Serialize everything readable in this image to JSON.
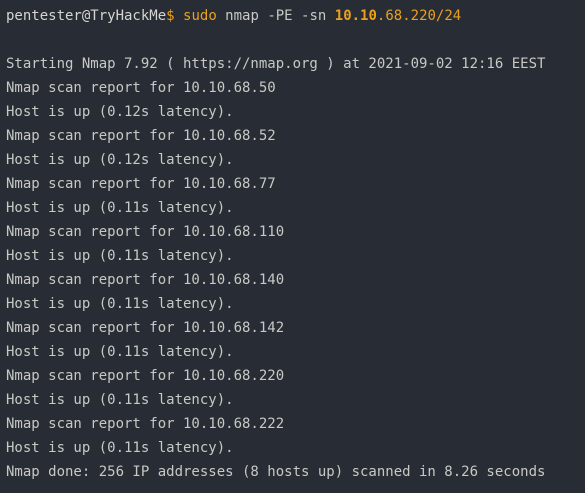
{
  "prompt": {
    "user_host": "pentester@TryHackMe",
    "symbol": "$",
    "sudo": "sudo",
    "args": " nmap -PE -sn ",
    "target_bold": "10.10",
    "target_rest": ".68.220/24"
  },
  "output": [
    "Starting Nmap 7.92 ( https://nmap.org ) at 2021-09-02 12:16 EEST",
    "Nmap scan report for 10.10.68.50",
    "Host is up (0.12s latency).",
    "Nmap scan report for 10.10.68.52",
    "Host is up (0.12s latency).",
    "Nmap scan report for 10.10.68.77",
    "Host is up (0.11s latency).",
    "Nmap scan report for 10.10.68.110",
    "Host is up (0.11s latency).",
    "Nmap scan report for 10.10.68.140",
    "Host is up (0.11s latency).",
    "Nmap scan report for 10.10.68.142",
    "Host is up (0.11s latency).",
    "Nmap scan report for 10.10.68.220",
    "Host is up (0.11s latency).",
    "Nmap scan report for 10.10.68.222",
    "Host is up (0.11s latency).",
    "Nmap done: 256 IP addresses (8 hosts up) scanned in 8.26 seconds"
  ],
  "colors": {
    "background": "#282c34",
    "text": "#c8c9c4",
    "accent": "#e9a11f"
  }
}
